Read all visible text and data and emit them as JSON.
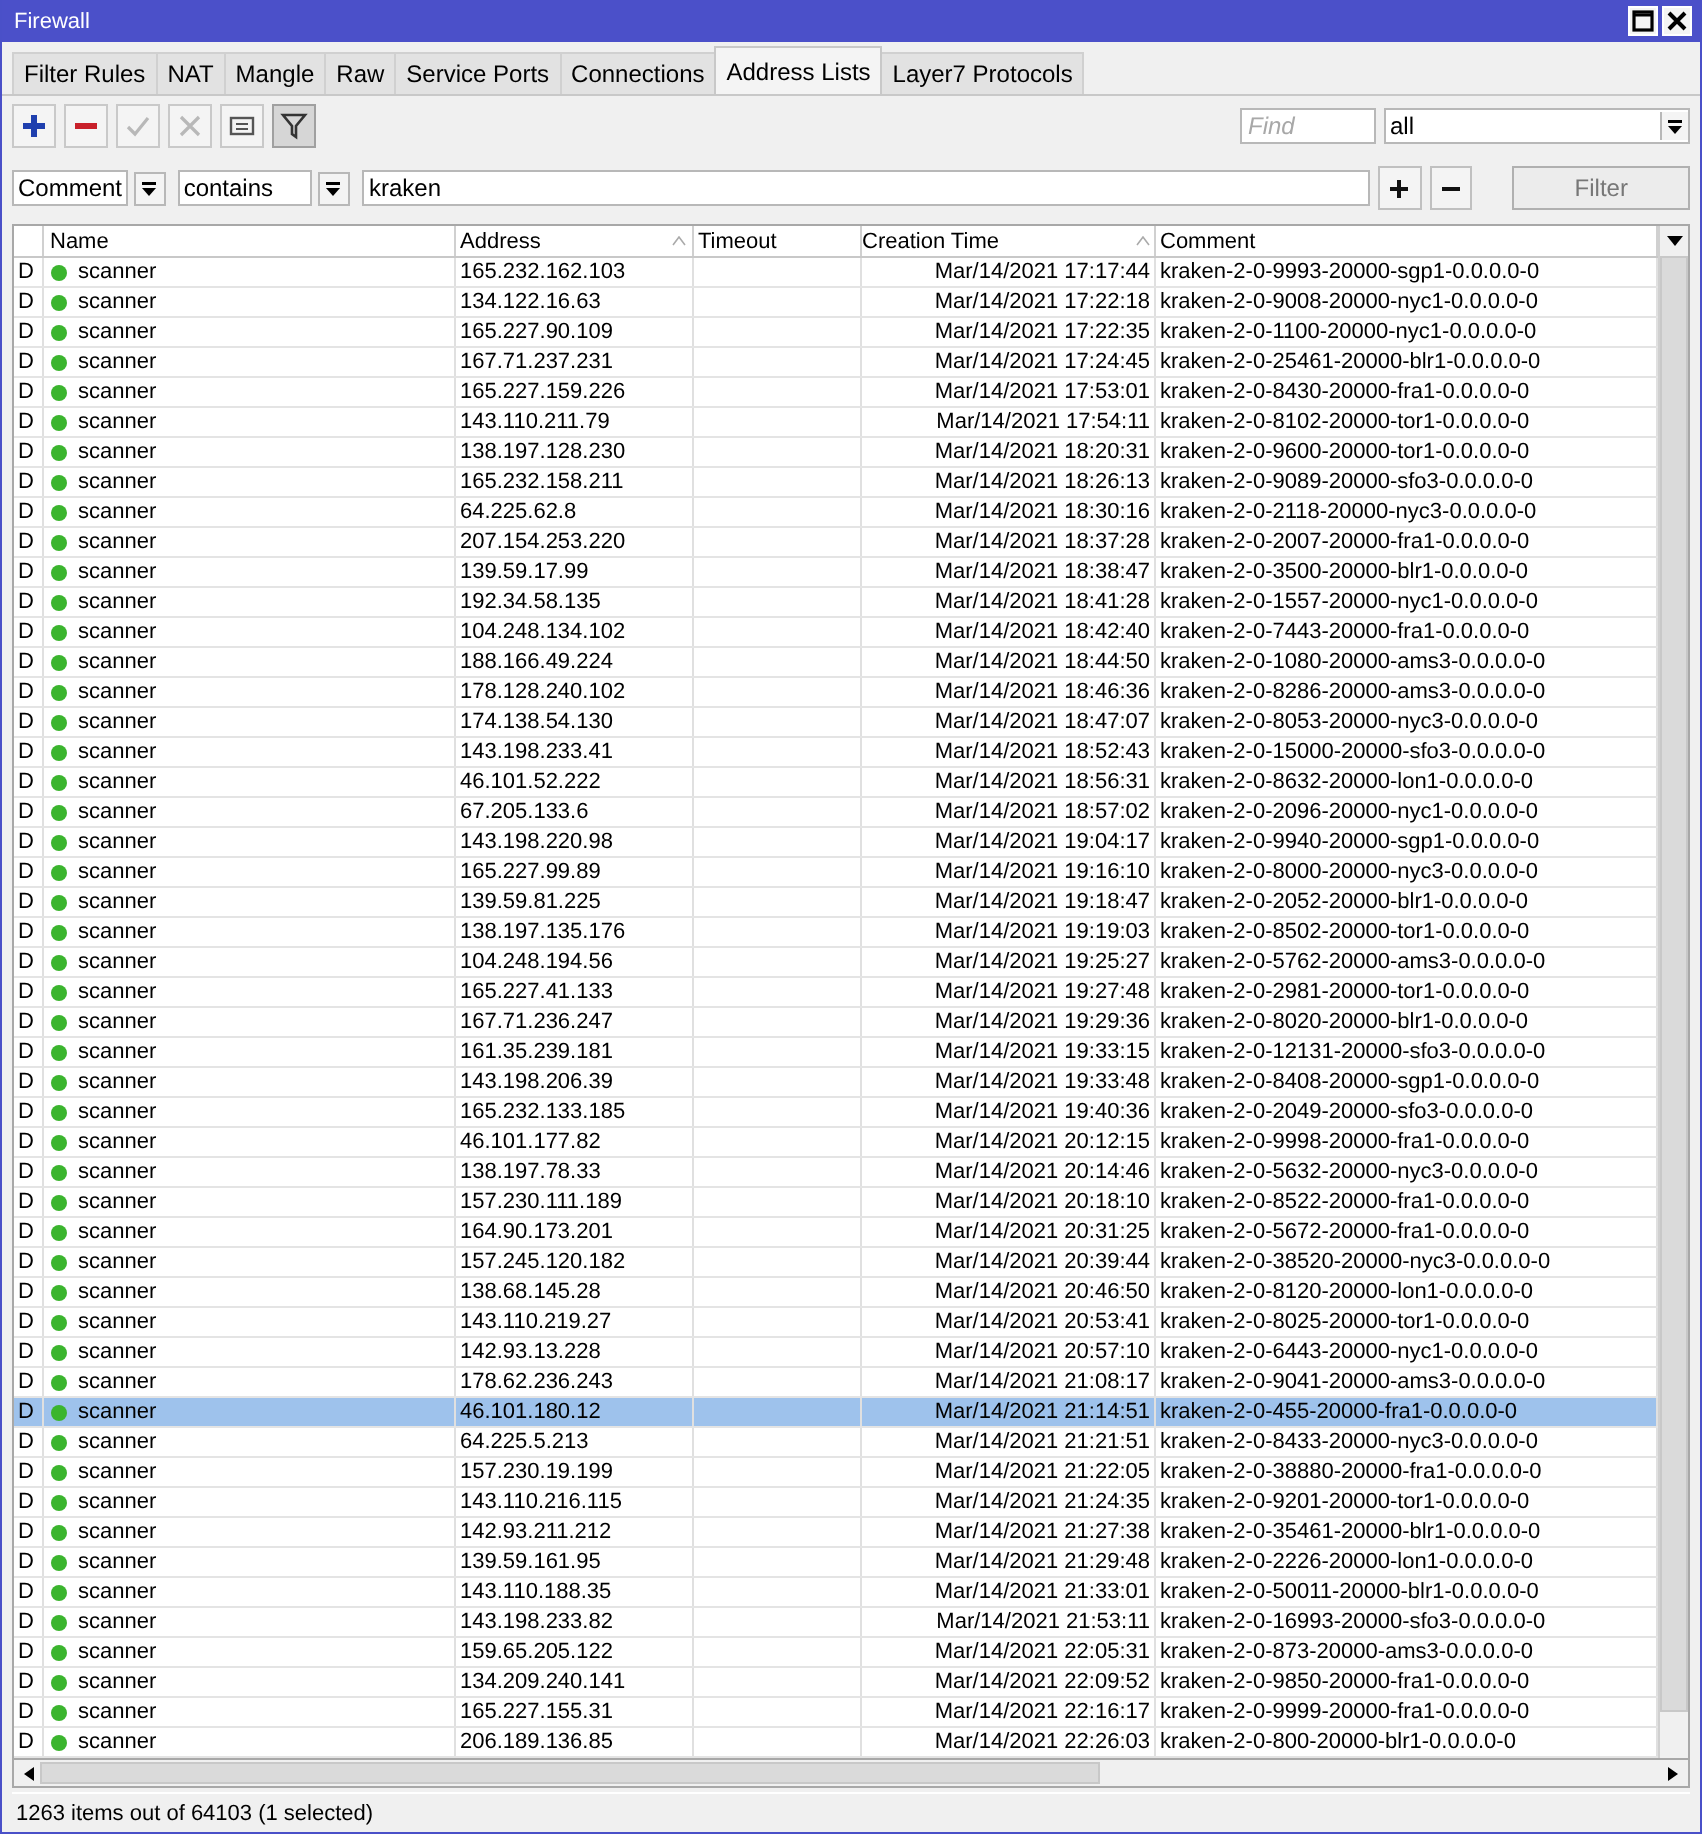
{
  "window": {
    "title": "Firewall"
  },
  "tabs": [
    {
      "label": "Filter Rules",
      "selected": false
    },
    {
      "label": "NAT",
      "selected": false
    },
    {
      "label": "Mangle",
      "selected": false
    },
    {
      "label": "Raw",
      "selected": false
    },
    {
      "label": "Service Ports",
      "selected": false
    },
    {
      "label": "Connections",
      "selected": false
    },
    {
      "label": "Address Lists",
      "selected": true
    },
    {
      "label": "Layer7 Protocols",
      "selected": false
    }
  ],
  "toolbar": [
    {
      "kind": "add",
      "disabled": false,
      "selected": false
    },
    {
      "kind": "remove",
      "disabled": false,
      "selected": false
    },
    {
      "kind": "enable",
      "disabled": true,
      "selected": false
    },
    {
      "kind": "disable",
      "disabled": true,
      "selected": false
    },
    {
      "kind": "comment",
      "disabled": false,
      "selected": false
    },
    {
      "kind": "filter",
      "disabled": false,
      "selected": true
    }
  ],
  "find": {
    "placeholder": "Find"
  },
  "list_select": {
    "value": "all"
  },
  "filter": {
    "property": "Comment",
    "operator": "contains",
    "value": "kraken",
    "button": "Filter"
  },
  "table": {
    "columns": [
      {
        "sorted": false
      },
      {
        "label": "Name",
        "sorted": false
      },
      {
        "label": "Address",
        "sorted": true
      },
      {
        "label": "Timeout",
        "sorted": false
      },
      {
        "label": "Creation Time",
        "sorted": true
      },
      {
        "label": "Comment",
        "sorted": false
      }
    ],
    "rows": [
      {
        "flag": "D",
        "name": "scanner",
        "address": "165.232.162.103",
        "creation_time": "Mar/14/2021 17:17:44",
        "comment": "kraken-2-0-9993-20000-sgp1-0.0.0.0-0",
        "selected": false
      },
      {
        "flag": "D",
        "name": "scanner",
        "address": "134.122.16.63",
        "creation_time": "Mar/14/2021 17:22:18",
        "comment": "kraken-2-0-9008-20000-nyc1-0.0.0.0-0",
        "selected": false
      },
      {
        "flag": "D",
        "name": "scanner",
        "address": "165.227.90.109",
        "creation_time": "Mar/14/2021 17:22:35",
        "comment": "kraken-2-0-1100-20000-nyc1-0.0.0.0-0",
        "selected": false
      },
      {
        "flag": "D",
        "name": "scanner",
        "address": "167.71.237.231",
        "creation_time": "Mar/14/2021 17:24:45",
        "comment": "kraken-2-0-25461-20000-blr1-0.0.0.0-0",
        "selected": false
      },
      {
        "flag": "D",
        "name": "scanner",
        "address": "165.227.159.226",
        "creation_time": "Mar/14/2021 17:53:01",
        "comment": "kraken-2-0-8430-20000-fra1-0.0.0.0-0",
        "selected": false
      },
      {
        "flag": "D",
        "name": "scanner",
        "address": "143.110.211.79",
        "creation_time": "Mar/14/2021 17:54:11",
        "comment": "kraken-2-0-8102-20000-tor1-0.0.0.0-0",
        "selected": false
      },
      {
        "flag": "D",
        "name": "scanner",
        "address": "138.197.128.230",
        "creation_time": "Mar/14/2021 18:20:31",
        "comment": "kraken-2-0-9600-20000-tor1-0.0.0.0-0",
        "selected": false
      },
      {
        "flag": "D",
        "name": "scanner",
        "address": "165.232.158.211",
        "creation_time": "Mar/14/2021 18:26:13",
        "comment": "kraken-2-0-9089-20000-sfo3-0.0.0.0-0",
        "selected": false
      },
      {
        "flag": "D",
        "name": "scanner",
        "address": "64.225.62.8",
        "creation_time": "Mar/14/2021 18:30:16",
        "comment": "kraken-2-0-2118-20000-nyc3-0.0.0.0-0",
        "selected": false
      },
      {
        "flag": "D",
        "name": "scanner",
        "address": "207.154.253.220",
        "creation_time": "Mar/14/2021 18:37:28",
        "comment": "kraken-2-0-2007-20000-fra1-0.0.0.0-0",
        "selected": false
      },
      {
        "flag": "D",
        "name": "scanner",
        "address": "139.59.17.99",
        "creation_time": "Mar/14/2021 18:38:47",
        "comment": "kraken-2-0-3500-20000-blr1-0.0.0.0-0",
        "selected": false
      },
      {
        "flag": "D",
        "name": "scanner",
        "address": "192.34.58.135",
        "creation_time": "Mar/14/2021 18:41:28",
        "comment": "kraken-2-0-1557-20000-nyc1-0.0.0.0-0",
        "selected": false
      },
      {
        "flag": "D",
        "name": "scanner",
        "address": "104.248.134.102",
        "creation_time": "Mar/14/2021 18:42:40",
        "comment": "kraken-2-0-7443-20000-fra1-0.0.0.0-0",
        "selected": false
      },
      {
        "flag": "D",
        "name": "scanner",
        "address": "188.166.49.224",
        "creation_time": "Mar/14/2021 18:44:50",
        "comment": "kraken-2-0-1080-20000-ams3-0.0.0.0-0",
        "selected": false
      },
      {
        "flag": "D",
        "name": "scanner",
        "address": "178.128.240.102",
        "creation_time": "Mar/14/2021 18:46:36",
        "comment": "kraken-2-0-8286-20000-ams3-0.0.0.0-0",
        "selected": false
      },
      {
        "flag": "D",
        "name": "scanner",
        "address": "174.138.54.130",
        "creation_time": "Mar/14/2021 18:47:07",
        "comment": "kraken-2-0-8053-20000-nyc3-0.0.0.0-0",
        "selected": false
      },
      {
        "flag": "D",
        "name": "scanner",
        "address": "143.198.233.41",
        "creation_time": "Mar/14/2021 18:52:43",
        "comment": "kraken-2-0-15000-20000-sfo3-0.0.0.0-0",
        "selected": false
      },
      {
        "flag": "D",
        "name": "scanner",
        "address": "46.101.52.222",
        "creation_time": "Mar/14/2021 18:56:31",
        "comment": "kraken-2-0-8632-20000-lon1-0.0.0.0-0",
        "selected": false
      },
      {
        "flag": "D",
        "name": "scanner",
        "address": "67.205.133.6",
        "creation_time": "Mar/14/2021 18:57:02",
        "comment": "kraken-2-0-2096-20000-nyc1-0.0.0.0-0",
        "selected": false
      },
      {
        "flag": "D",
        "name": "scanner",
        "address": "143.198.220.98",
        "creation_time": "Mar/14/2021 19:04:17",
        "comment": "kraken-2-0-9940-20000-sgp1-0.0.0.0-0",
        "selected": false
      },
      {
        "flag": "D",
        "name": "scanner",
        "address": "165.227.99.89",
        "creation_time": "Mar/14/2021 19:16:10",
        "comment": "kraken-2-0-8000-20000-nyc3-0.0.0.0-0",
        "selected": false
      },
      {
        "flag": "D",
        "name": "scanner",
        "address": "139.59.81.225",
        "creation_time": "Mar/14/2021 19:18:47",
        "comment": "kraken-2-0-2052-20000-blr1-0.0.0.0-0",
        "selected": false
      },
      {
        "flag": "D",
        "name": "scanner",
        "address": "138.197.135.176",
        "creation_time": "Mar/14/2021 19:19:03",
        "comment": "kraken-2-0-8502-20000-tor1-0.0.0.0-0",
        "selected": false
      },
      {
        "flag": "D",
        "name": "scanner",
        "address": "104.248.194.56",
        "creation_time": "Mar/14/2021 19:25:27",
        "comment": "kraken-2-0-5762-20000-ams3-0.0.0.0-0",
        "selected": false
      },
      {
        "flag": "D",
        "name": "scanner",
        "address": "165.227.41.133",
        "creation_time": "Mar/14/2021 19:27:48",
        "comment": "kraken-2-0-2981-20000-tor1-0.0.0.0-0",
        "selected": false
      },
      {
        "flag": "D",
        "name": "scanner",
        "address": "167.71.236.247",
        "creation_time": "Mar/14/2021 19:29:36",
        "comment": "kraken-2-0-8020-20000-blr1-0.0.0.0-0",
        "selected": false
      },
      {
        "flag": "D",
        "name": "scanner",
        "address": "161.35.239.181",
        "creation_time": "Mar/14/2021 19:33:15",
        "comment": "kraken-2-0-12131-20000-sfo3-0.0.0.0-0",
        "selected": false
      },
      {
        "flag": "D",
        "name": "scanner",
        "address": "143.198.206.39",
        "creation_time": "Mar/14/2021 19:33:48",
        "comment": "kraken-2-0-8408-20000-sgp1-0.0.0.0-0",
        "selected": false
      },
      {
        "flag": "D",
        "name": "scanner",
        "address": "165.232.133.185",
        "creation_time": "Mar/14/2021 19:40:36",
        "comment": "kraken-2-0-2049-20000-sfo3-0.0.0.0-0",
        "selected": false
      },
      {
        "flag": "D",
        "name": "scanner",
        "address": "46.101.177.82",
        "creation_time": "Mar/14/2021 20:12:15",
        "comment": "kraken-2-0-9998-20000-fra1-0.0.0.0-0",
        "selected": false
      },
      {
        "flag": "D",
        "name": "scanner",
        "address": "138.197.78.33",
        "creation_time": "Mar/14/2021 20:14:46",
        "comment": "kraken-2-0-5632-20000-nyc3-0.0.0.0-0",
        "selected": false
      },
      {
        "flag": "D",
        "name": "scanner",
        "address": "157.230.111.189",
        "creation_time": "Mar/14/2021 20:18:10",
        "comment": "kraken-2-0-8522-20000-fra1-0.0.0.0-0",
        "selected": false
      },
      {
        "flag": "D",
        "name": "scanner",
        "address": "164.90.173.201",
        "creation_time": "Mar/14/2021 20:31:25",
        "comment": "kraken-2-0-5672-20000-fra1-0.0.0.0-0",
        "selected": false
      },
      {
        "flag": "D",
        "name": "scanner",
        "address": "157.245.120.182",
        "creation_time": "Mar/14/2021 20:39:44",
        "comment": "kraken-2-0-38520-20000-nyc3-0.0.0.0-0",
        "selected": false
      },
      {
        "flag": "D",
        "name": "scanner",
        "address": "138.68.145.28",
        "creation_time": "Mar/14/2021 20:46:50",
        "comment": "kraken-2-0-8120-20000-lon1-0.0.0.0-0",
        "selected": false
      },
      {
        "flag": "D",
        "name": "scanner",
        "address": "143.110.219.27",
        "creation_time": "Mar/14/2021 20:53:41",
        "comment": "kraken-2-0-8025-20000-tor1-0.0.0.0-0",
        "selected": false
      },
      {
        "flag": "D",
        "name": "scanner",
        "address": "142.93.13.228",
        "creation_time": "Mar/14/2021 20:57:10",
        "comment": "kraken-2-0-6443-20000-nyc1-0.0.0.0-0",
        "selected": false
      },
      {
        "flag": "D",
        "name": "scanner",
        "address": "178.62.236.243",
        "creation_time": "Mar/14/2021 21:08:17",
        "comment": "kraken-2-0-9041-20000-ams3-0.0.0.0-0",
        "selected": false
      },
      {
        "flag": "D",
        "name": "scanner",
        "address": "46.101.180.12",
        "creation_time": "Mar/14/2021 21:14:51",
        "comment": "kraken-2-0-455-20000-fra1-0.0.0.0-0",
        "selected": true
      },
      {
        "flag": "D",
        "name": "scanner",
        "address": "64.225.5.213",
        "creation_time": "Mar/14/2021 21:21:51",
        "comment": "kraken-2-0-8433-20000-nyc3-0.0.0.0-0",
        "selected": false
      },
      {
        "flag": "D",
        "name": "scanner",
        "address": "157.230.19.199",
        "creation_time": "Mar/14/2021 21:22:05",
        "comment": "kraken-2-0-38880-20000-fra1-0.0.0.0-0",
        "selected": false
      },
      {
        "flag": "D",
        "name": "scanner",
        "address": "143.110.216.115",
        "creation_time": "Mar/14/2021 21:24:35",
        "comment": "kraken-2-0-9201-20000-tor1-0.0.0.0-0",
        "selected": false
      },
      {
        "flag": "D",
        "name": "scanner",
        "address": "142.93.211.212",
        "creation_time": "Mar/14/2021 21:27:38",
        "comment": "kraken-2-0-35461-20000-blr1-0.0.0.0-0",
        "selected": false
      },
      {
        "flag": "D",
        "name": "scanner",
        "address": "139.59.161.95",
        "creation_time": "Mar/14/2021 21:29:48",
        "comment": "kraken-2-0-2226-20000-lon1-0.0.0.0-0",
        "selected": false
      },
      {
        "flag": "D",
        "name": "scanner",
        "address": "143.110.188.35",
        "creation_time": "Mar/14/2021 21:33:01",
        "comment": "kraken-2-0-50011-20000-blr1-0.0.0.0-0",
        "selected": false
      },
      {
        "flag": "D",
        "name": "scanner",
        "address": "143.198.233.82",
        "creation_time": "Mar/14/2021 21:53:11",
        "comment": "kraken-2-0-16993-20000-sfo3-0.0.0.0-0",
        "selected": false
      },
      {
        "flag": "D",
        "name": "scanner",
        "address": "159.65.205.122",
        "creation_time": "Mar/14/2021 22:05:31",
        "comment": "kraken-2-0-873-20000-ams3-0.0.0.0-0",
        "selected": false
      },
      {
        "flag": "D",
        "name": "scanner",
        "address": "134.209.240.141",
        "creation_time": "Mar/14/2021 22:09:52",
        "comment": "kraken-2-0-9850-20000-fra1-0.0.0.0-0",
        "selected": false
      },
      {
        "flag": "D",
        "name": "scanner",
        "address": "165.227.155.31",
        "creation_time": "Mar/14/2021 22:16:17",
        "comment": "kraken-2-0-9999-20000-fra1-0.0.0.0-0",
        "selected": false
      },
      {
        "flag": "D",
        "name": "scanner",
        "address": "206.189.136.85",
        "creation_time": "Mar/14/2021 22:26:03",
        "comment": "kraken-2-0-800-20000-blr1-0.0.0.0-0",
        "selected": false
      }
    ]
  },
  "status_bar": "1263 items out of 64103 (1 selected)"
}
